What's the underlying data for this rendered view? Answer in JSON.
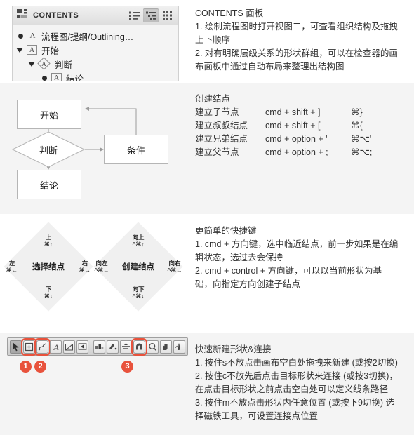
{
  "colors": {
    "band_gray": "#f4f4f4",
    "accent_red": "#e8523c",
    "text": "#333333",
    "shape_border": "#b5b5b5"
  },
  "section1": {
    "panel": {
      "title": "CONTENTS",
      "panel_icon": "panel-grid-icon",
      "view_buttons": [
        {
          "name": "list-view-icon",
          "label": "",
          "active": false
        },
        {
          "name": "outline-view-icon",
          "label": "",
          "active": true
        },
        {
          "name": "grid-view-icon",
          "label": "",
          "active": false
        }
      ],
      "tree": [
        {
          "marker": "disc",
          "glyph": "A-plain",
          "label": "流程图/提纲/Outlining…",
          "indent": 0
        },
        {
          "marker": "triangle",
          "glyph": "A-box",
          "label": "开始",
          "indent": 0
        },
        {
          "marker": "triangle",
          "glyph": "A-diamond",
          "label": "判断",
          "indent": 1
        },
        {
          "marker": "disc",
          "glyph": "A-box",
          "label": "结论",
          "indent": 2
        }
      ]
    },
    "desc": {
      "title": "CONTENTS 面板",
      "lines": [
        "1. 绘制流程图时打开视图二，可查看组织结构及拖拽",
        "上下顺序",
        "2. 对有明确层级关系的形状群组，可以在检查器的画",
        "布面板中通过自动布局来整理出结构图"
      ]
    }
  },
  "section2": {
    "flowchart": {
      "nodes": [
        {
          "id": "start",
          "label": "开始",
          "shape": "rect"
        },
        {
          "id": "decision",
          "label": "判断",
          "shape": "diamond"
        },
        {
          "id": "condition",
          "label": "条件",
          "shape": "rect"
        },
        {
          "id": "conclusion",
          "label": "结论",
          "shape": "rect"
        }
      ]
    },
    "desc": {
      "title": "创建结点",
      "rows": [
        {
          "name": "建立子节点",
          "combo": "cmd +  shift  + ]",
          "symbol": "⌘}"
        },
        {
          "name": "建立叔叔结点",
          "combo": "cmd +  shift  + [",
          "symbol": "⌘{"
        },
        {
          "name": "建立兄弟结点",
          "combo": "cmd + option + '",
          "symbol": "⌘⌥'"
        },
        {
          "name": "建立父节点",
          "combo": "cmd + option + ;",
          "symbol": "⌘⌥;"
        }
      ]
    }
  },
  "section3": {
    "diamonds": [
      {
        "center": "选择结点",
        "top_label": "上",
        "top_key": "⌘↑",
        "bottom_label": "下",
        "bottom_key": "⌘↓",
        "left_label": "左",
        "left_key": "⌘←",
        "right_label": "右",
        "right_key": "⌘→"
      },
      {
        "center": "创建结点",
        "top_label": "向上",
        "top_key": "^⌘↑",
        "bottom_label": "向下",
        "bottom_key": "^⌘↓",
        "left_label": "向左",
        "left_key": "^⌘←",
        "right_label": "向右",
        "right_key": "^⌘→"
      }
    ],
    "desc": {
      "title": "更简单的快捷键",
      "lines": [
        "1. cmd + 方向键，选中临近结点，前一步如果是在编",
        "辑状态，选过去会保持",
        "2. cmd + control + 方向键，可以以当前形状为基",
        "础，向指定方向创建子结点"
      ]
    }
  },
  "section4": {
    "toolbar": {
      "tools": [
        {
          "name": "selection-arrow-tool",
          "highlight": false,
          "selected": true
        },
        {
          "name": "shape-tool",
          "highlight": true,
          "selected": false
        },
        {
          "name": "line-pen-tool",
          "highlight": true,
          "selected": false
        },
        {
          "name": "text-tool",
          "highlight": false,
          "selected": false
        },
        {
          "name": "crop-tool",
          "highlight": false,
          "selected": false
        },
        {
          "name": "playback-tool",
          "highlight": false,
          "selected": false
        },
        {
          "name": "style-swatch-tool",
          "highlight": false,
          "selected": false,
          "gap": true
        },
        {
          "name": "paintbrush-tool",
          "highlight": false,
          "selected": false
        },
        {
          "name": "align-tool",
          "highlight": false,
          "selected": false
        },
        {
          "name": "magnet-tool",
          "highlight": true,
          "selected": false
        },
        {
          "name": "zoom-tool",
          "highlight": false,
          "selected": false
        },
        {
          "name": "hand-tool",
          "highlight": false,
          "selected": false
        },
        {
          "name": "pointer-hand-tool",
          "highlight": false,
          "selected": false
        }
      ],
      "badges": [
        {
          "label": "1"
        },
        {
          "label": "2"
        },
        {
          "label": "3"
        }
      ]
    },
    "desc": {
      "title": "快速新建形状&连接",
      "lines": [
        "1. 按住s不放点击画布空白处拖拽来新建 (或按2切换)",
        "2. 按住c不放先后点击目标形状来连接 (或按3切换)，",
        "在点击目标形状之前点击空白处可以定义线条路径",
        "3. 按住m不放点击形状内任意位置 (或按下9切换) 选",
        "择磁铁工具，可设置连接点位置"
      ]
    }
  }
}
